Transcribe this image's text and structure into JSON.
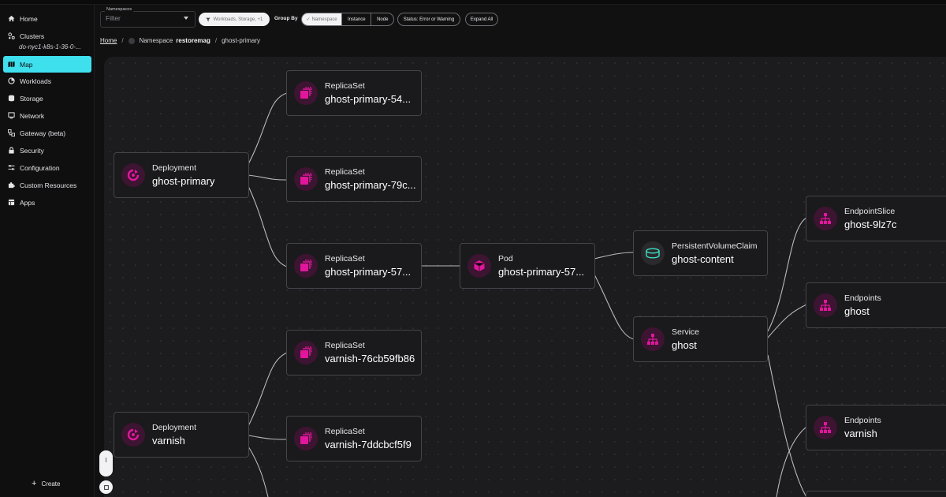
{
  "sidebar": {
    "items": [
      {
        "label": "Home",
        "icon": "home-icon"
      },
      {
        "label": "Clusters",
        "icon": "clusters-icon"
      },
      {
        "label": "Map",
        "icon": "map-icon"
      },
      {
        "label": "Workloads",
        "icon": "workloads-icon"
      },
      {
        "label": "Storage",
        "icon": "storage-icon"
      },
      {
        "label": "Network",
        "icon": "network-icon"
      },
      {
        "label": "Gateway (beta)",
        "icon": "gateway-icon"
      },
      {
        "label": "Security",
        "icon": "lock-icon"
      },
      {
        "label": "Configuration",
        "icon": "sliders-icon"
      },
      {
        "label": "Custom Resources",
        "icon": "puzzle-icon"
      },
      {
        "label": "Apps",
        "icon": "apps-icon"
      }
    ],
    "cluster_name": "do-nyc1-k8s-1-36-0-...",
    "active": "Map",
    "create_label": "Create"
  },
  "toolbar": {
    "namespaces_label": "Namespaces",
    "namespaces_placeholder": "Filter",
    "filter_chip": "Workloads, Storage, +1",
    "group_by_label": "Group By",
    "group_by_options": [
      "Namespace",
      "Instance",
      "Node"
    ],
    "group_by_selected": "Namespace",
    "status_button": "Status: Error or Warning",
    "expand_button": "Expand All"
  },
  "breadcrumb": {
    "home": "Home",
    "namespace_label": "Namespace",
    "namespace_value": "restoremag",
    "current": "ghost-primary"
  },
  "graph": {
    "nodes": [
      {
        "kind": "Deployment",
        "name": "ghost-primary",
        "icon": "deployment-icon"
      },
      {
        "kind": "Deployment",
        "name": "varnish",
        "icon": "deployment-icon"
      },
      {
        "kind": "ReplicaSet",
        "name": "ghost-primary-54...",
        "icon": "replicaset-icon"
      },
      {
        "kind": "ReplicaSet",
        "name": "ghost-primary-79c...",
        "icon": "replicaset-icon"
      },
      {
        "kind": "ReplicaSet",
        "name": "ghost-primary-57...",
        "icon": "replicaset-icon"
      },
      {
        "kind": "ReplicaSet",
        "name": "varnish-76cb59fb86",
        "icon": "replicaset-icon"
      },
      {
        "kind": "ReplicaSet",
        "name": "varnish-7ddcbcf5f9",
        "icon": "replicaset-icon"
      },
      {
        "kind": "Pod",
        "name": "ghost-primary-57...",
        "icon": "pod-icon"
      },
      {
        "kind": "PersistentVolumeClaim",
        "name": "ghost-content",
        "icon": "pvc-icon"
      },
      {
        "kind": "Service",
        "name": "ghost",
        "icon": "service-icon"
      },
      {
        "kind": "EndpointSlice",
        "name": "ghost-9lz7c",
        "icon": "endpointslice-icon"
      },
      {
        "kind": "Endpoints",
        "name": "ghost",
        "icon": "endpoints-icon"
      },
      {
        "kind": "Endpoints",
        "name": "varnish",
        "icon": "endpoints-icon"
      }
    ]
  },
  "colors": {
    "accent": "#3fe0ee",
    "icon_magenta": "#e0179c",
    "icon_bg": "#3d1431",
    "pvc_teal": "#3de0c8",
    "canvas_bg": "#1c1c1e",
    "node_bg": "#1a1a1c",
    "node_border": "#44444a"
  }
}
